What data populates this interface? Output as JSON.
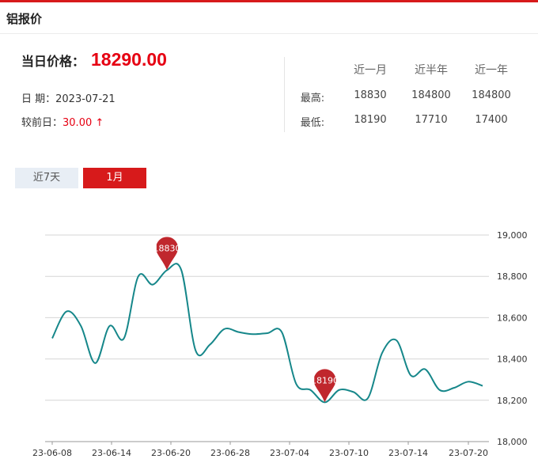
{
  "header": {
    "title": "铝报价"
  },
  "summary": {
    "price_label": "当日价格：",
    "price_value": "18290.00",
    "date_text": "日  期：2023-07-21",
    "change_label": "较前日：",
    "change_value": "30.00 ↑",
    "accent_color": "#e60012"
  },
  "stats": {
    "headers": [
      "近一月",
      "近半年",
      "近一年"
    ],
    "rows": [
      {
        "label": "最高:",
        "values": [
          "18830",
          "184800",
          "184800"
        ]
      },
      {
        "label": "最低:",
        "values": [
          "18190",
          "17710",
          "17400"
        ]
      }
    ]
  },
  "tabs": [
    {
      "label": "近7天",
      "active": false
    },
    {
      "label": "1月",
      "active": true
    }
  ],
  "chart_data": {
    "type": "line",
    "x_ticks": [
      "23-06-08",
      "23-06-14",
      "23-06-20",
      "23-06-28",
      "23-07-04",
      "23-07-10",
      "23-07-14",
      "23-07-20"
    ],
    "y_ticks": [
      "19,000",
      "18,800",
      "18,600",
      "18,400",
      "18,200",
      "18,000"
    ],
    "ylim": [
      18000,
      19000
    ],
    "line_color": "#16878a",
    "grid": true,
    "x": [
      0,
      0.5,
      1,
      1.5,
      2,
      2.5,
      3,
      3.5,
      4,
      4.5,
      5,
      5.5,
      6,
      6.5,
      7,
      7.5,
      8,
      8.5,
      9,
      9.5,
      10,
      10.5,
      11,
      11.5,
      12,
      12.5,
      13,
      13.5,
      14,
      14.5,
      15,
      15.5,
      16,
      16.5,
      17,
      17.5,
      18,
      18.5,
      19,
      19.5,
      20,
      20.5,
      21,
      21.5,
      22,
      22.5,
      23,
      23.5,
      24
    ],
    "values": [
      18500,
      18630,
      18560,
      18380,
      18560,
      18500,
      18800,
      18760,
      18830,
      18830,
      18440,
      18470,
      18545,
      18530,
      18520,
      18525,
      18530,
      18280,
      18250,
      18190,
      18250,
      18240,
      18210,
      18430,
      18490,
      18320,
      18350,
      18250,
      18260,
      18290,
      18270,
      18290,
      18290,
      18290,
      18290,
      18290,
      18290,
      18290,
      18290,
      18290,
      18290,
      18290,
      18290,
      18290,
      18290,
      18290,
      18290,
      18290,
      18290
    ],
    "markers": [
      {
        "label": "18830",
        "x": 4,
        "value": 18830,
        "color": "#c0272d"
      },
      {
        "label": "18190",
        "x": 9.5,
        "value": 18190,
        "color": "#c0272d"
      }
    ]
  }
}
